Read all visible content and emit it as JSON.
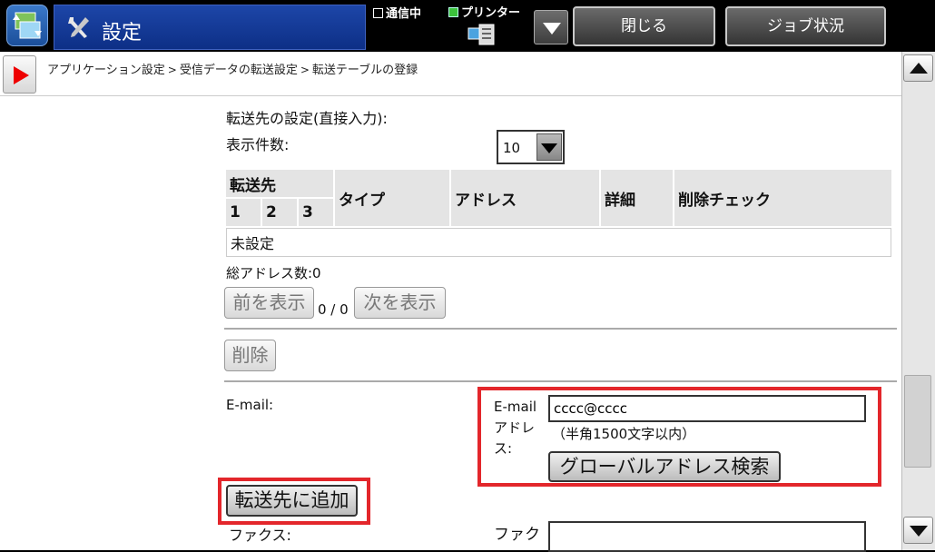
{
  "header": {
    "title": "設定",
    "status_comm": "通信中",
    "status_printer": "プリンター",
    "close_label": "閉じる",
    "job_status_label": "ジョブ状況"
  },
  "breadcrumb": [
    "アプリケーション設定",
    "受信データの転送設定",
    "転送テーブルの登録"
  ],
  "form": {
    "destination_heading": "転送先の設定(直接入力):",
    "display_count_label": "表示件数:",
    "display_count_value": "10",
    "table": {
      "col_dest": "転送先",
      "sub_cols": [
        "1",
        "2",
        "3"
      ],
      "col_type": "タイプ",
      "col_address": "アドレス",
      "col_detail": "詳細",
      "col_delete": "削除チェック",
      "empty_text": "未設定"
    },
    "total_label": "総アドレス数:0",
    "prev_label": "前を表示",
    "page_info": "0 / 0",
    "next_label": "次を表示",
    "delete_label": "削除",
    "email_label": "E-mail:",
    "email_address_label": "E-mail アドレス:",
    "email_value": "cccc@cccc",
    "email_hint": "（半角1500文字以内）",
    "global_search_label": "グローバルアドレス検索",
    "add_label": "転送先に追加",
    "fax_label": "ファクス:",
    "fax_number_label": "ファク"
  },
  "colors": {
    "highlight": "#e3262b",
    "title_bar": "#1d46a8"
  }
}
